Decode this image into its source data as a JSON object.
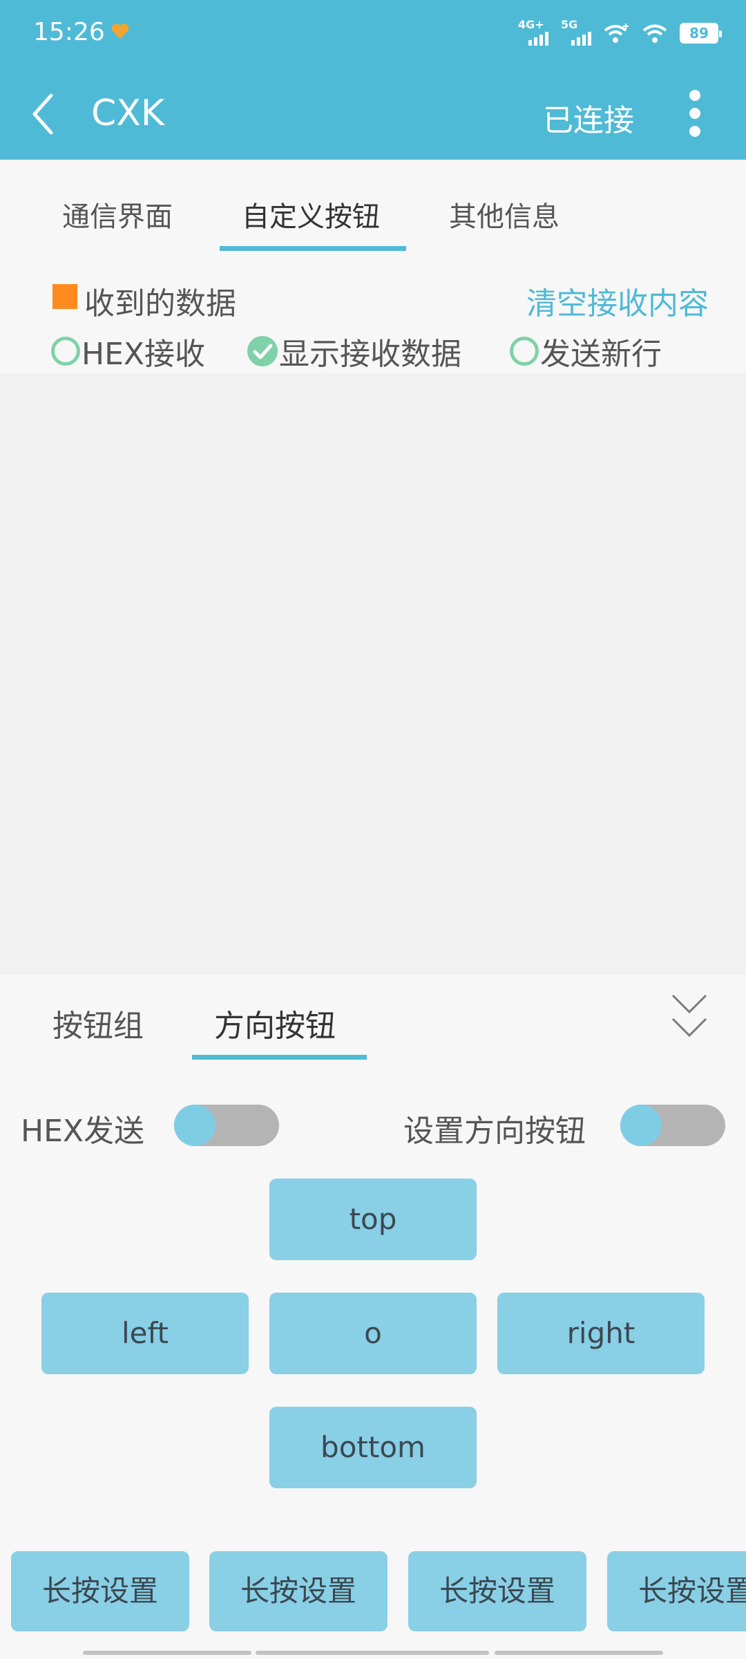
{
  "status_bar": {
    "time": "15:26",
    "net1": "4G+",
    "net2": "5G",
    "battery": "89"
  },
  "appbar": {
    "title": "CXK",
    "status": "已连接"
  },
  "tabs": [
    {
      "label": "通信界面",
      "active": false
    },
    {
      "label": "自定义按钮",
      "active": true
    },
    {
      "label": "其他信息",
      "active": false
    }
  ],
  "receive": {
    "label": "收到的数据",
    "clear_label": "清空接收内容",
    "accent_color": "#ff8a1f"
  },
  "options": [
    {
      "label": "HEX接收",
      "checked": false
    },
    {
      "label": "显示接收数据",
      "checked": true
    },
    {
      "label": "发送新行",
      "checked": false
    }
  ],
  "panel": {
    "tabs": [
      {
        "label": "按钮组",
        "active": false
      },
      {
        "label": "方向按钮",
        "active": true
      }
    ],
    "hex_send_label": "HEX发送",
    "set_direction_label": "设置方向按钮",
    "hex_send_on": false,
    "set_direction_on": false
  },
  "direction_buttons": {
    "top": "top",
    "left": "left",
    "center": "o",
    "right": "right",
    "bottom": "bottom"
  },
  "long_press_buttons": [
    "长按设置",
    "长按设置",
    "长按设置",
    "长按设置"
  ],
  "colors": {
    "primary": "#4fbad6",
    "button": "#89cfe6",
    "check": "#7fd1a8"
  }
}
